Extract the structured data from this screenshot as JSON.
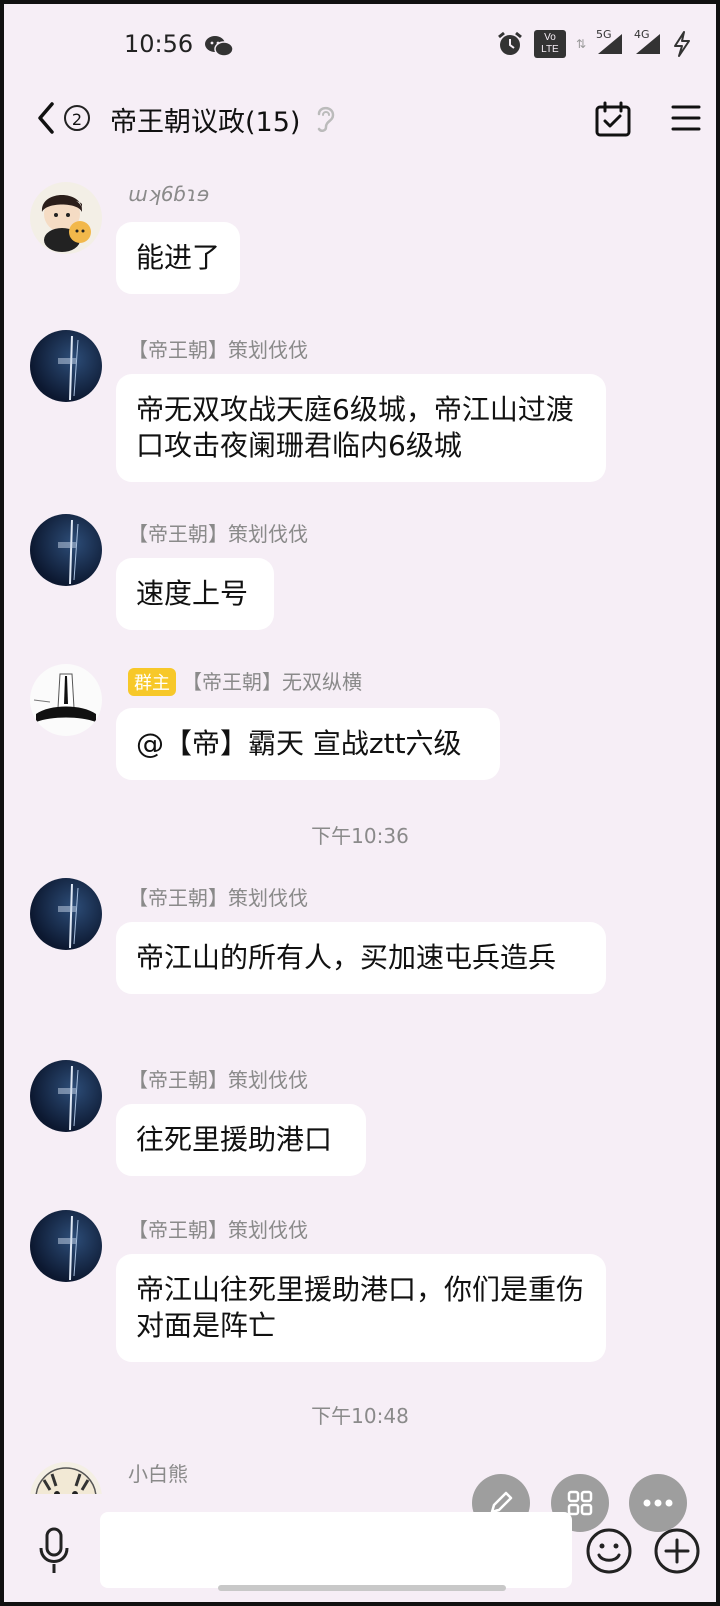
{
  "status_bar": {
    "time": "10:56",
    "signal_5g": "5G",
    "signal_4g": "4G",
    "volte": "Vo LTE"
  },
  "header": {
    "unread_count": "2",
    "title": "帝王朝议政(15)"
  },
  "messages": [
    {
      "sender": "ɯʞ6ɓɿɘ",
      "text": "能进了"
    },
    {
      "sender": "【帝王朝】策划伐伐",
      "text": "帝无双攻战天庭6级城，帝江山过渡口攻击夜阑珊君临内6级城"
    },
    {
      "sender": "【帝王朝】策划伐伐",
      "text": "速度上号"
    },
    {
      "role_tag": "群主",
      "sender": "【帝王朝】无双纵横",
      "text": "@【帝】霸天 宣战ztt六级"
    },
    {
      "sender": "【帝王朝】策划伐伐",
      "text": "帝江山的所有人，买加速屯兵造兵"
    },
    {
      "sender": "【帝王朝】策划伐伐",
      "text": "往死里援助港口"
    },
    {
      "sender": "【帝王朝】策划伐伐",
      "text": "帝江山往死里援助港口，你们是重伤对面是阵亡"
    },
    {
      "sender": "小白熊",
      "text": ""
    }
  ],
  "timestamps": [
    "下午10:36",
    "下午10:48"
  ],
  "input_bar": {
    "placeholder": ""
  }
}
